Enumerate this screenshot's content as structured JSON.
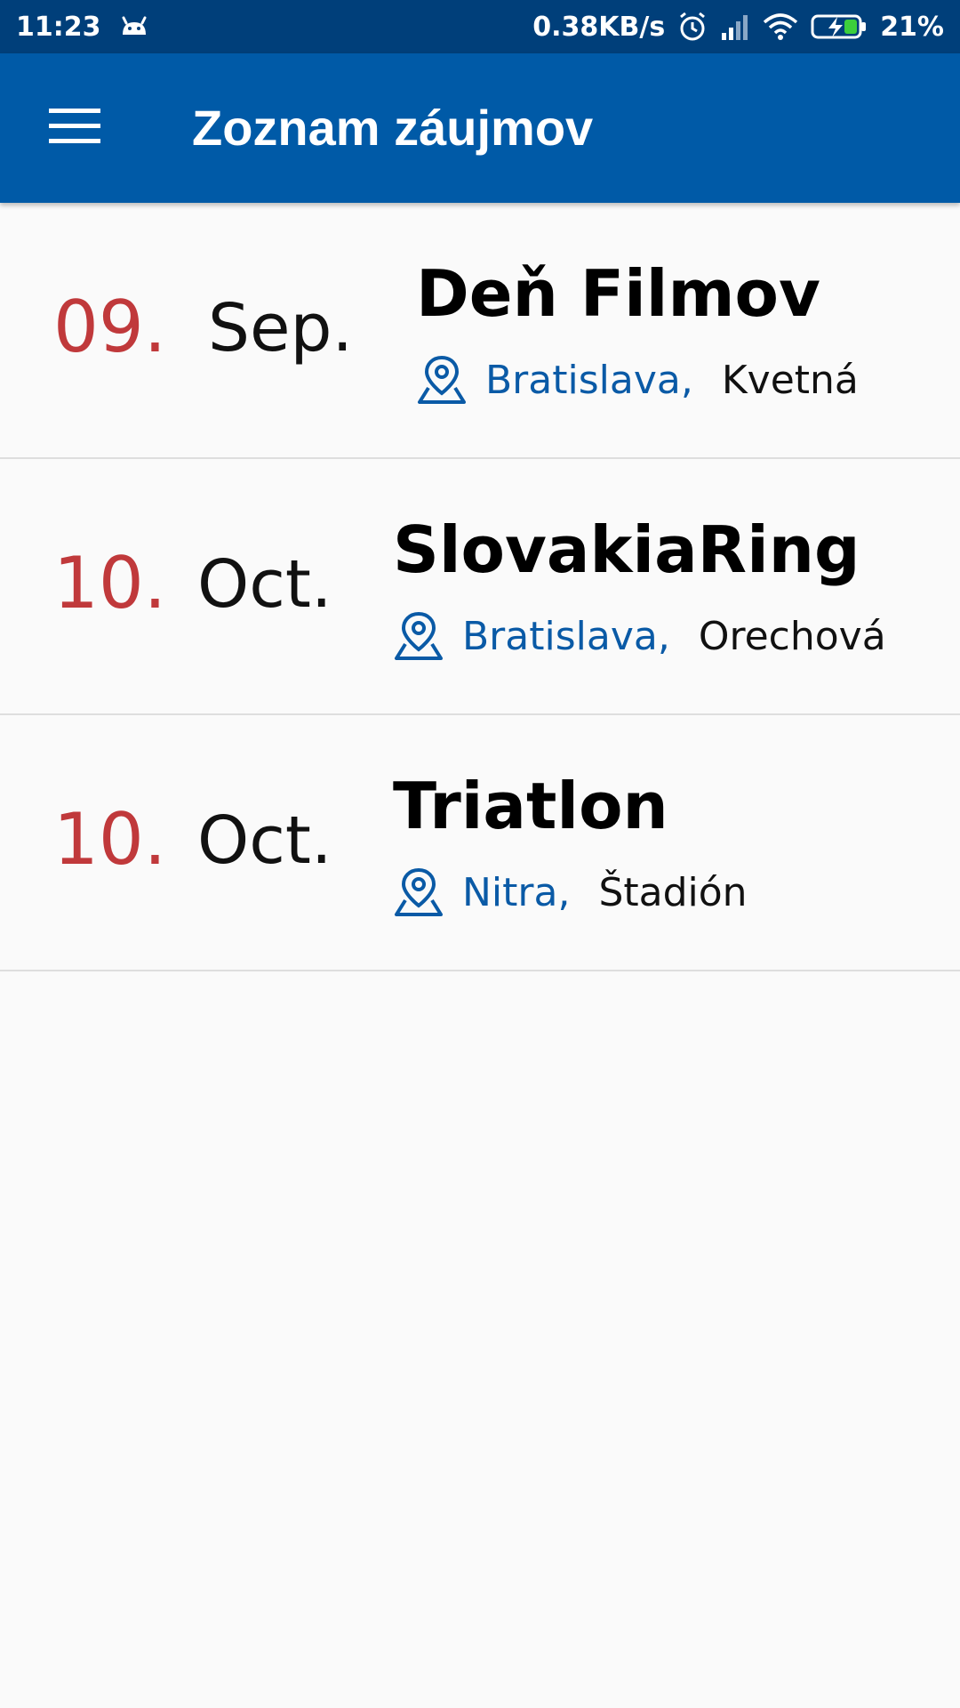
{
  "status_bar": {
    "time": "11:23",
    "network_speed": "0.38KB/s",
    "battery_percent": "21%",
    "icons": [
      "android-notification-icon",
      "alarm-icon",
      "signal-icon",
      "wifi-icon",
      "battery-charging-icon"
    ]
  },
  "app_bar": {
    "menu_icon": "hamburger-menu-icon",
    "title": "Zoznam záujmov",
    "background_color": "#005aa7"
  },
  "events": [
    {
      "day": "09.",
      "month": "Sep.",
      "title": "Deň Filmov",
      "city": "Bratislava,",
      "street": "Kvetná"
    },
    {
      "day": "10.",
      "month": "Oct.",
      "title": "SlovakiaRing",
      "city": "Bratislava,",
      "street": "Orechová"
    },
    {
      "day": "10.",
      "month": "Oct.",
      "title": "Triatlon",
      "city": "Nitra,",
      "street": "Štadión"
    }
  ],
  "colors": {
    "day": "#c0393b",
    "city": "#0a5aa6",
    "status_bar": "#003f7a"
  }
}
